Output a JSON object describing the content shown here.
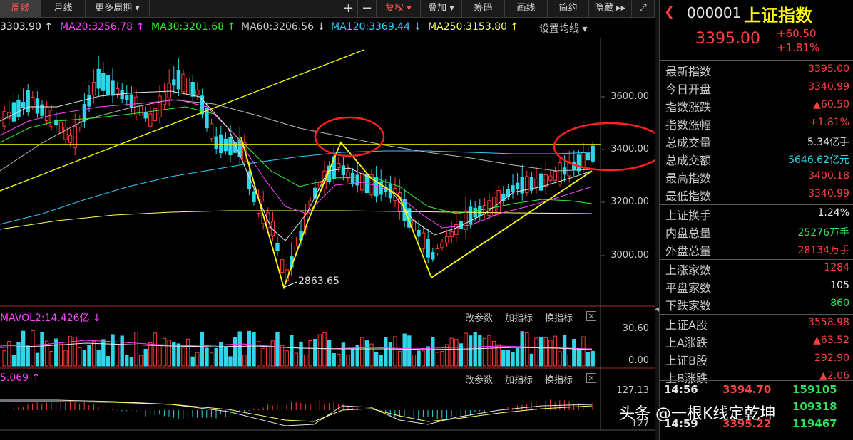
{
  "toolbar": {
    "tabs": [
      "周线",
      "月线",
      "更多周期 ▾"
    ],
    "plus": "+",
    "minus": "−",
    "buttons": [
      "复权 ▾",
      "叠加 ▾",
      "筹码",
      "画线",
      "简约",
      "隐藏 ▸▸"
    ]
  },
  "ma_legend": {
    "ma10": "3303.90 ↑",
    "ma20": "MA20:3256.78 ↑",
    "ma30": "MA30:3201.68 ↑",
    "ma60": "MA60:3206.56 ↓",
    "ma120": "MA120:3369.44 ↓",
    "ma250": "MA250:3153.80 ↑",
    "settings": "设置均线 ▾"
  },
  "price_axis": [
    "3600.00",
    "3400.00",
    "3200.00",
    "3000.00"
  ],
  "low_annotation": "2863.65",
  "vol_panel": {
    "label": "MAVOL2:14.426亿 ↓",
    "buttons": [
      "改参数",
      "加指标",
      "换指标"
    ],
    "close": "✕",
    "axis": [
      "30.60",
      "0.00"
    ]
  },
  "macd_panel": {
    "label": "5.069 ↑",
    "buttons": [
      "改参数",
      "加指标",
      "换指标"
    ],
    "close": "✕",
    "axis": [
      "127.13",
      "-127"
    ]
  },
  "right_panel": {
    "code": "000001",
    "name": "上证指数",
    "price": "3395.00",
    "change": "+60.50",
    "change_pct": "+1.81%",
    "stats": [
      {
        "label": "最新指数",
        "value": "3395.00",
        "color": "red"
      },
      {
        "label": "今日开盘",
        "value": "3340.99",
        "color": "red"
      },
      {
        "label": "指数涨跌",
        "value": "▲60.50",
        "color": "red"
      },
      {
        "label": "指数涨幅",
        "value": "+1.81%",
        "color": "red"
      },
      {
        "label": "总成交量",
        "value": "5.34亿手",
        "color": "white"
      },
      {
        "label": "总成交额",
        "value": "5646.62亿元",
        "color": "cyan"
      },
      {
        "label": "最高指数",
        "value": "3400.18",
        "color": "red"
      },
      {
        "label": "最低指数",
        "value": "3340.99",
        "color": "red"
      }
    ],
    "stats2": [
      {
        "label": "上证换手",
        "value": "1.24%",
        "color": "white"
      },
      {
        "label": "内盘总量",
        "value": "25276万手",
        "color": "green"
      },
      {
        "label": "外盘总量",
        "value": "28134万手",
        "color": "red"
      }
    ],
    "stats3": [
      {
        "label": "上涨家数",
        "value": "1284",
        "color": "red"
      },
      {
        "label": "平盘家数",
        "value": "105",
        "color": "white"
      },
      {
        "label": "下跌家数",
        "value": "860",
        "color": "green"
      }
    ],
    "stats4": [
      {
        "label": "上证A股",
        "value": "3558.98",
        "color": "red"
      },
      {
        "label": "上A涨跌",
        "value": "▲63.52",
        "color": "red"
      },
      {
        "label": "上证B股",
        "value": "292.90",
        "color": "red"
      },
      {
        "label": "上B涨跌",
        "value": "▲2.06",
        "color": "red"
      }
    ],
    "ticks": [
      {
        "time": "14:56",
        "price": "3394.70",
        "vol": "159105"
      },
      {
        "time": "",
        "price": "",
        "vol": "109318"
      },
      {
        "time": "14:59",
        "price": "3395.22",
        "vol": "119467"
      }
    ]
  },
  "watermark": "头条 @一根K线定乾坤"
}
